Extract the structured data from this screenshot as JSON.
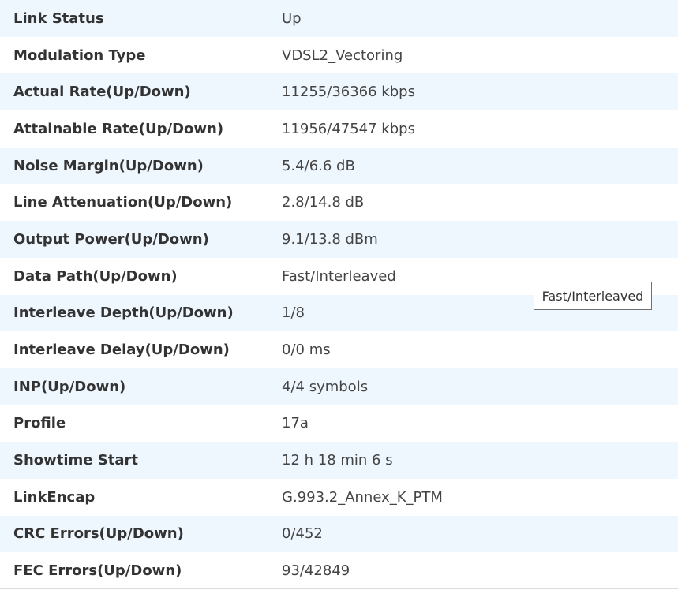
{
  "rows": [
    {
      "label": "Link Status",
      "value": "Up"
    },
    {
      "label": "Modulation Type",
      "value": "VDSL2_Vectoring"
    },
    {
      "label": "Actual Rate(Up/Down)",
      "value": "11255/36366 kbps"
    },
    {
      "label": "Attainable Rate(Up/Down)",
      "value": "11956/47547 kbps"
    },
    {
      "label": "Noise Margin(Up/Down)",
      "value": "5.4/6.6 dB"
    },
    {
      "label": "Line Attenuation(Up/Down)",
      "value": "2.8/14.8 dB"
    },
    {
      "label": "Output Power(Up/Down)",
      "value": "9.1/13.8 dBm"
    },
    {
      "label": "Data Path(Up/Down)",
      "value": "Fast/Interleaved"
    },
    {
      "label": "Interleave Depth(Up/Down)",
      "value": "1/8"
    },
    {
      "label": "Interleave Delay(Up/Down)",
      "value": "0/0 ms"
    },
    {
      "label": "INP(Up/Down)",
      "value": "4/4 symbols"
    },
    {
      "label": "Profile",
      "value": "17a"
    },
    {
      "label": "Showtime Start",
      "value": "12 h 18 min 6 s"
    },
    {
      "label": "LinkEncap",
      "value": "G.993.2_Annex_K_PTM"
    },
    {
      "label": "CRC Errors(Up/Down)",
      "value": "0/452"
    },
    {
      "label": "FEC Errors(Up/Down)",
      "value": "93/42849"
    }
  ],
  "tooltip": {
    "text": "Fast/Interleaved"
  },
  "colors": {
    "row_alt_background": "#eef6fe",
    "row_background": "#ffffff",
    "label_text": "#333333",
    "value_text": "#444444",
    "tooltip_border": "#707070"
  }
}
